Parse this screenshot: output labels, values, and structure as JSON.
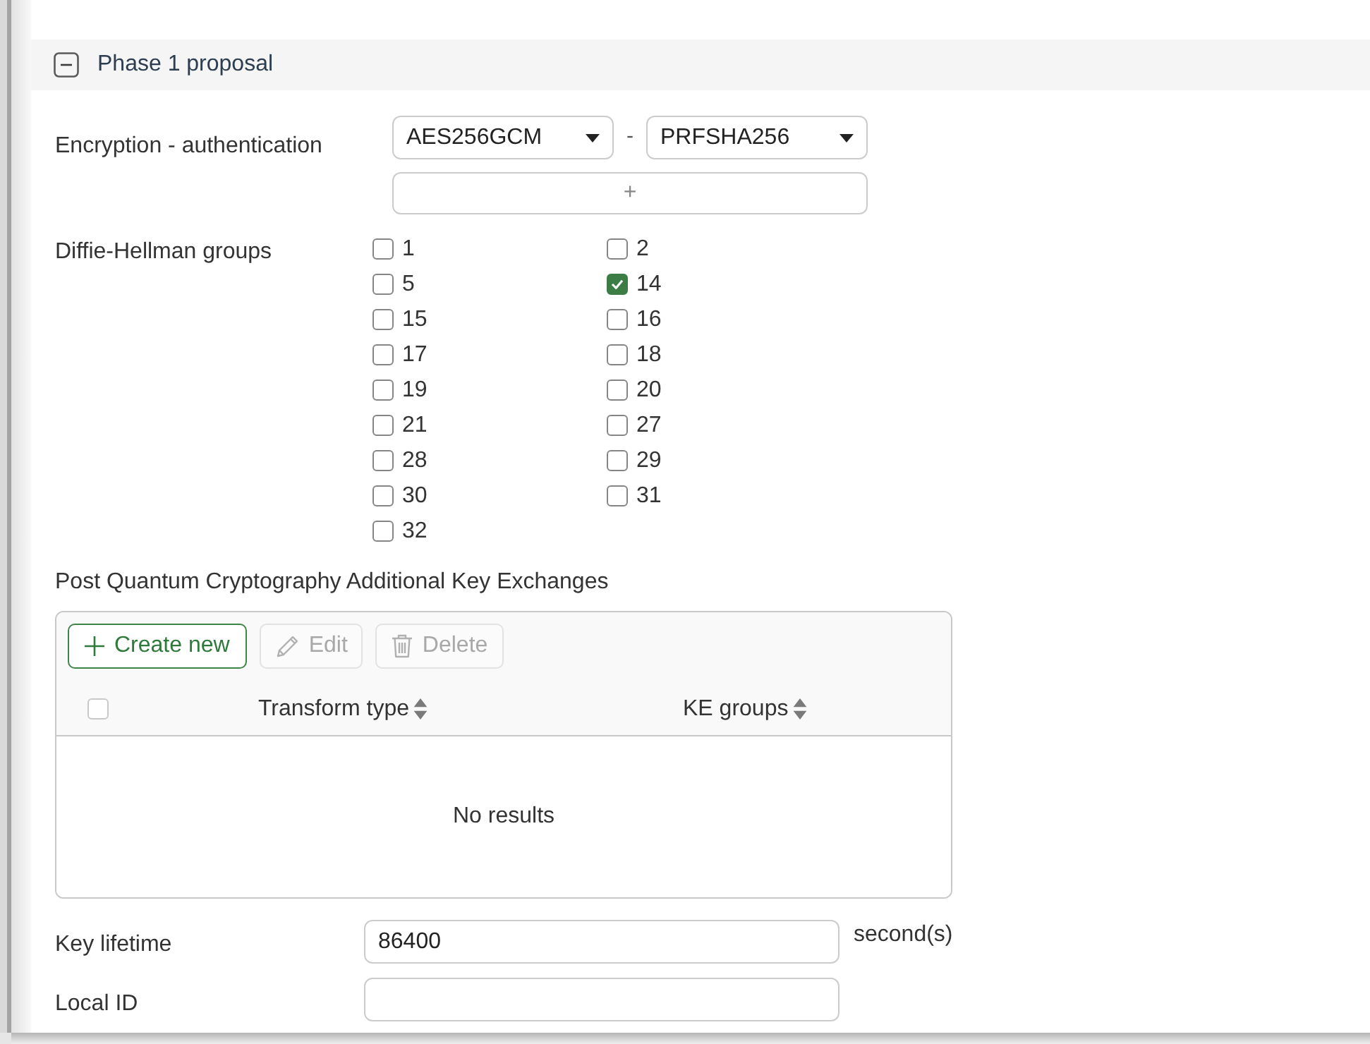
{
  "section": {
    "title": "Phase 1 proposal",
    "expanded": true
  },
  "encryption_authentication": {
    "label": "Encryption - authentication",
    "encryption": "AES256GCM",
    "separator": "-",
    "authentication": "PRFSHA256",
    "add_button": "+"
  },
  "dh_groups": {
    "label": "Diffie-Hellman groups",
    "options": [
      {
        "label": "1",
        "checked": false
      },
      {
        "label": "2",
        "checked": false
      },
      {
        "label": "5",
        "checked": false
      },
      {
        "label": "14",
        "checked": true
      },
      {
        "label": "15",
        "checked": false
      },
      {
        "label": "16",
        "checked": false
      },
      {
        "label": "17",
        "checked": false
      },
      {
        "label": "18",
        "checked": false
      },
      {
        "label": "19",
        "checked": false
      },
      {
        "label": "20",
        "checked": false
      },
      {
        "label": "21",
        "checked": false
      },
      {
        "label": "27",
        "checked": false
      },
      {
        "label": "28",
        "checked": false
      },
      {
        "label": "29",
        "checked": false
      },
      {
        "label": "30",
        "checked": false
      },
      {
        "label": "31",
        "checked": false
      },
      {
        "label": "32",
        "checked": false
      }
    ]
  },
  "pqc_key_exchanges": {
    "title": "Post Quantum Cryptography Additional Key Exchanges",
    "toolbar": [
      {
        "kind": "create",
        "label": "Create new",
        "disabled": false
      },
      {
        "kind": "edit",
        "label": "Edit",
        "disabled": true
      },
      {
        "kind": "delete",
        "label": "Delete",
        "disabled": true
      }
    ],
    "select_all": {
      "checked": false
    },
    "columns": [
      {
        "label": "Transform type",
        "sortable": true
      },
      {
        "label": "KE groups",
        "sortable": true
      }
    ],
    "empty_text": "No results"
  },
  "key_lifetime": {
    "label": "Key lifetime",
    "value": "86400",
    "unit": "second(s)"
  },
  "local_id": {
    "label": "Local ID"
  }
}
